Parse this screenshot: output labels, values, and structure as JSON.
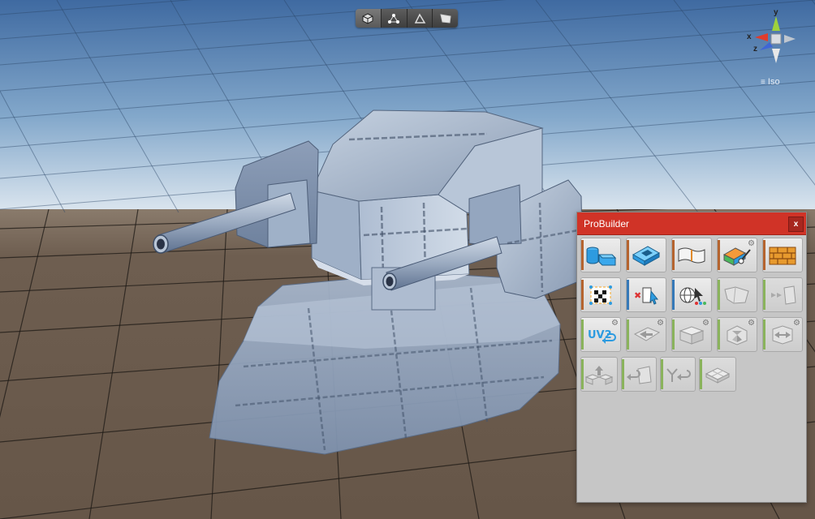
{
  "scene": {
    "toolbar_modes": [
      {
        "name": "object-mode",
        "icon": "cube-icon"
      },
      {
        "name": "vertex-mode",
        "icon": "vertex-icon"
      },
      {
        "name": "edge-mode",
        "icon": "edge-icon"
      },
      {
        "name": "face-mode",
        "icon": "face-icon"
      }
    ],
    "gizmo": {
      "x": "x",
      "y": "y",
      "z": "z",
      "projection": "Iso"
    },
    "colors": {
      "sky_top": "#3e6aa0",
      "sky_horizon": "#d9e4ee",
      "ground": "#6c5c4e",
      "grid": "#1e1a16",
      "mesh": "#a6b6cc",
      "panel_title": "#d03327"
    }
  },
  "probuilder": {
    "title": "ProBuilder",
    "close": "x",
    "buttons": [
      {
        "name": "new-shape-button",
        "icon": "new-shape-icon",
        "enabled": true,
        "category": "orange",
        "gear": false
      },
      {
        "name": "new-poly-shape-button",
        "icon": "poly-shape-icon",
        "enabled": true,
        "category": "orange",
        "gear": false
      },
      {
        "name": "material-editor-button",
        "icon": "material-editor-icon",
        "enabled": true,
        "category": "orange",
        "gear": false
      },
      {
        "name": "vertex-colors-button",
        "icon": "vertex-colors-icon",
        "enabled": true,
        "category": "orange",
        "gear": true
      },
      {
        "name": "smoothing-button",
        "icon": "brick-wall-icon",
        "enabled": true,
        "category": "orange",
        "gear": false
      },
      {
        "name": "uv-editor-button",
        "icon": "uv-editor-icon",
        "enabled": true,
        "category": "orange",
        "gear": false
      },
      {
        "name": "toggle-handle-button",
        "icon": "handle-cursor-icon",
        "enabled": true,
        "category": "blue",
        "gear": false
      },
      {
        "name": "select-by-color-button",
        "icon": "globe-select-icon",
        "enabled": true,
        "category": "blue",
        "gear": false
      },
      {
        "name": "shape-button-disabled",
        "icon": "paper-shape-icon",
        "enabled": false,
        "category": "green",
        "gear": false
      },
      {
        "name": "grow-selection-button",
        "icon": "arrows-face-icon",
        "enabled": false,
        "category": "green",
        "gear": false
      },
      {
        "name": "lightmap-uvs-button",
        "icon": "uv2-icon",
        "enabled": true,
        "category": "green",
        "gear": true
      },
      {
        "name": "flip-normals-button",
        "icon": "arrow-left-face-icon",
        "enabled": false,
        "category": "green",
        "gear": true
      },
      {
        "name": "extrude-button",
        "icon": "extrude-box-icon",
        "enabled": false,
        "category": "green",
        "gear": true
      },
      {
        "name": "center-pivot-button",
        "icon": "pivot-icon",
        "enabled": false,
        "category": "green",
        "gear": true
      },
      {
        "name": "mirror-button",
        "icon": "mirror-icon",
        "enabled": false,
        "category": "green",
        "gear": true
      },
      {
        "name": "export-button",
        "icon": "boxes-up-icon",
        "enabled": false,
        "category": "green",
        "gear": false
      },
      {
        "name": "conform-normals-button",
        "icon": "arrow-face-icon",
        "enabled": false,
        "category": "green",
        "gear": false
      },
      {
        "name": "merge-objects-button",
        "icon": "merge-arrow-icon",
        "enabled": false,
        "category": "green",
        "gear": false
      },
      {
        "name": "triangulate-button",
        "icon": "cube-flat-icon",
        "enabled": false,
        "category": "green",
        "gear": false
      }
    ],
    "uv2_label": "UV2"
  }
}
